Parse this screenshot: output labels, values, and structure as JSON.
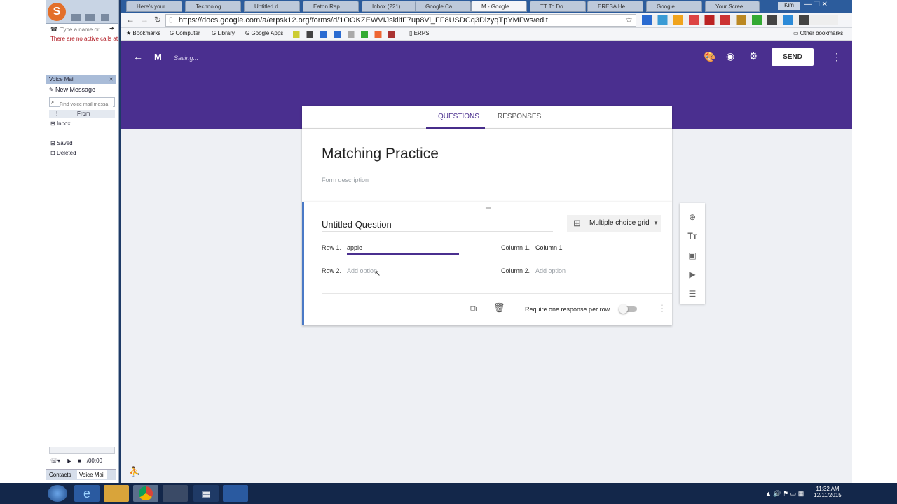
{
  "softphone": {
    "search_placeholder": "Type a name or",
    "active_calls": "There are no active calls at",
    "voicemail_title": "Voice Mail",
    "new_message": "New Message",
    "find_placeholder": "Find voice mail messa",
    "col_from": "From",
    "inbox": "Inbox",
    "saved": "Saved",
    "deleted": "Deleted",
    "timer": "/00:00",
    "tab_contacts": "Contacts",
    "tab_voicemail": "Voice Mail"
  },
  "browser": {
    "tabs": [
      {
        "label": "Here's your"
      },
      {
        "label": "Technolog"
      },
      {
        "label": "Untitled d"
      },
      {
        "label": "Eaton Rap"
      },
      {
        "label": "Inbox (221)"
      },
      {
        "label": "Google Ca"
      },
      {
        "label": "M - Google"
      },
      {
        "label": "TT To Do"
      },
      {
        "label": "ERESA He"
      },
      {
        "label": "Google"
      },
      {
        "label": "Your Scree"
      }
    ],
    "url": "https://docs.google.com/a/erpsk12.org/forms/d/1OOKZEWVIJskiifF7up8Vi_FF8USDCq3DizyqTpYMFws/edit",
    "user": "Kim",
    "bookmarks": [
      {
        "label": "Bookmarks"
      },
      {
        "label": "Computer"
      },
      {
        "label": "Library"
      },
      {
        "label": "Google Apps"
      },
      {
        "label": "ERPS"
      }
    ],
    "other_bookmarks": "Other bookmarks"
  },
  "forms": {
    "doc_title": "M",
    "status": "Saving...",
    "send_label": "SEND",
    "tabs": [
      {
        "label": "QUESTIONS"
      },
      {
        "label": "RESPONSES"
      }
    ],
    "form_title": "Matching Practice",
    "form_description_placeholder": "Form description",
    "question": {
      "title": "Untitled Question",
      "type": "Multiple choice grid",
      "rows": [
        {
          "label": "Row 1.",
          "value": "apple"
        },
        {
          "label": "Row 2.",
          "value": "Add option"
        }
      ],
      "columns": [
        {
          "label": "Column 1.",
          "value": "Column 1"
        },
        {
          "label": "Column 2.",
          "value": "Add option"
        }
      ],
      "require_label": "Require one response per row",
      "require_on": false
    },
    "accent": "#4a2f8f"
  },
  "taskbar": {
    "time": "11:32 AM",
    "date": "12/11/2015"
  }
}
